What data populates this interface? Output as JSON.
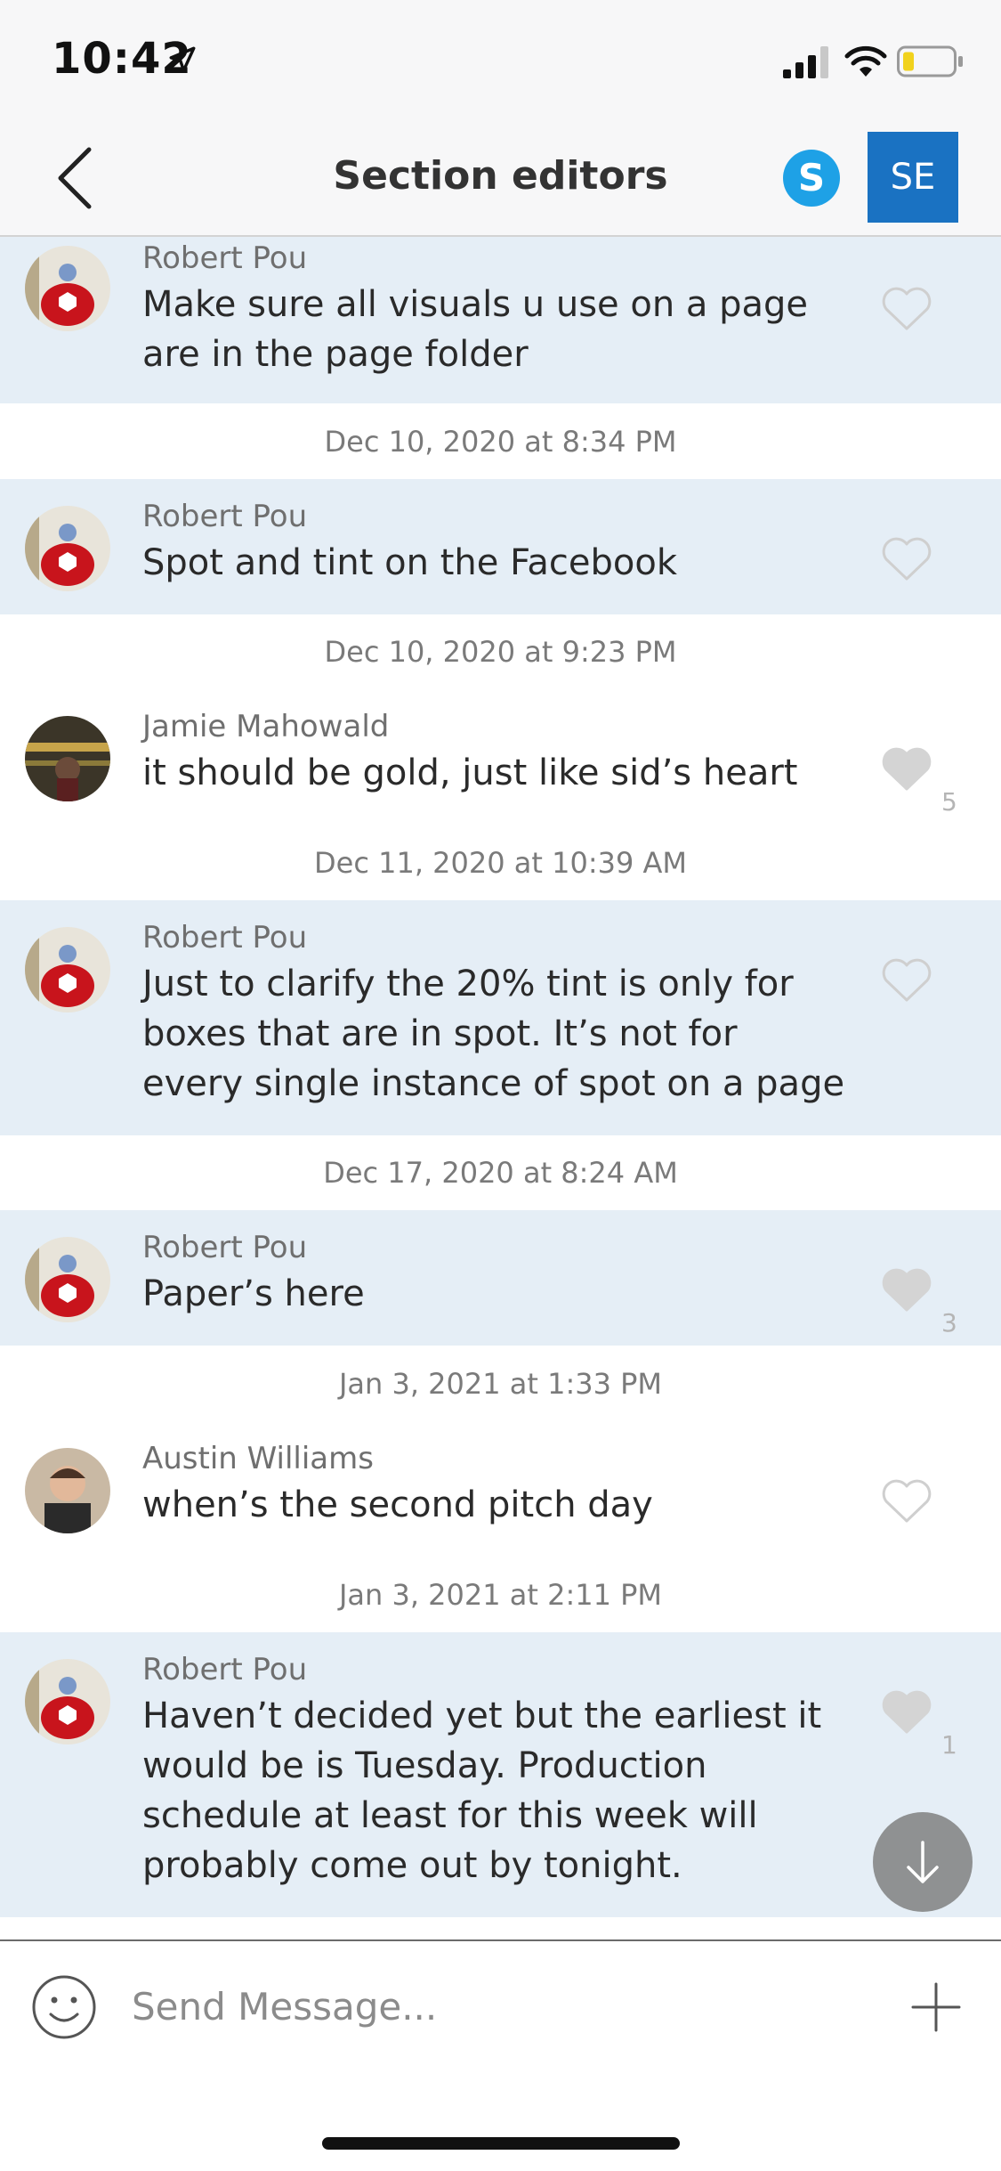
{
  "status_bar": {
    "time": "10:42"
  },
  "header": {
    "title": "Section editors",
    "skype_label": "S",
    "initials": "SE"
  },
  "messages": [
    {
      "sender": "Robert Pou",
      "text": "Make sure all visuals u use on a page are in the page folder",
      "likes": "",
      "liked": false
    },
    {
      "sender": "Robert Pou",
      "text": "Spot and tint on the Facebook",
      "likes": "",
      "liked": false
    },
    {
      "sender": "Jamie Mahowald",
      "text": "it should be gold, just like sid’s heart",
      "likes": "5",
      "liked": true
    },
    {
      "sender": "Robert Pou",
      "text": "Just to clarify the 20% tint is only for boxes that are in spot. It’s not for every single instance of spot on a page",
      "likes": "",
      "liked": false
    },
    {
      "sender": "Robert Pou",
      "text": "Paper’s here",
      "likes": "3",
      "liked": true
    },
    {
      "sender": "Austin Williams",
      "text": "when’s the second pitch day",
      "likes": "",
      "liked": false
    },
    {
      "sender": "Robert Pou",
      "text": "Haven’t decided yet but the earliest it would be is Tuesday. Production schedule at least for this week will probably come out by tonight.",
      "likes": "1",
      "liked": true
    }
  ],
  "dates": [
    "Dec 10, 2020 at 8:34 PM",
    "Dec 10, 2020 at 9:23 PM",
    "Dec 11, 2020 at 10:39 AM",
    "Dec 17, 2020 at 8:24 AM",
    "Jan 3, 2021 at 1:33 PM",
    "Jan 3, 2021 at 2:11 PM"
  ],
  "composer": {
    "placeholder": "Send Message..."
  },
  "colors": {
    "highlight_bg": "#e5eef6",
    "accent": "#1a72c2",
    "skype": "#1ea1e6"
  },
  "icons": [
    "location-arrow-icon",
    "signal-icon",
    "wifi-icon",
    "battery-icon",
    "back-chevron-icon",
    "skype-icon",
    "heart-icon",
    "arrow-down-icon",
    "emoji-icon",
    "plus-icon"
  ]
}
